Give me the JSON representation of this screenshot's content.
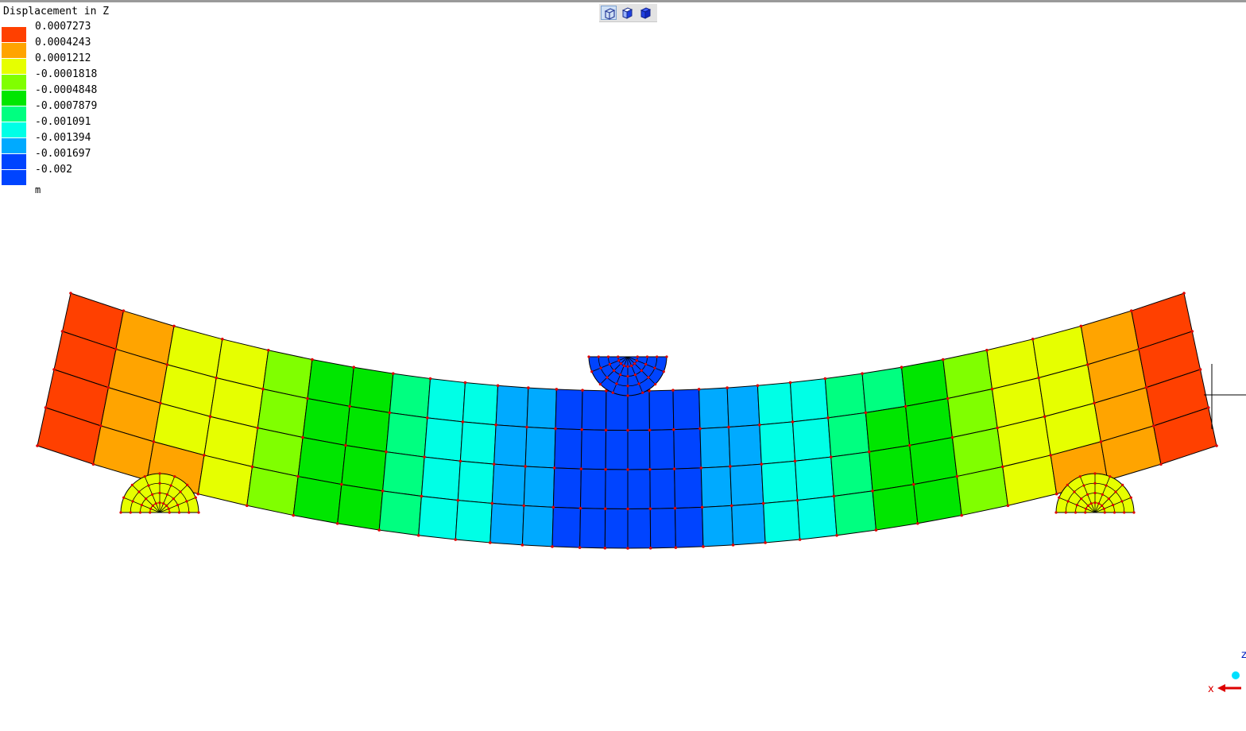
{
  "legend": {
    "title": "Displacement in Z",
    "unit": "m",
    "entries": [
      {
        "label": "0.0007273",
        "color": "#ff4000"
      },
      {
        "label": "0.0004243",
        "color": "#ffa400"
      },
      {
        "label": "0.0001212",
        "color": "#e6ff00"
      },
      {
        "label": "-0.0001818",
        "color": "#80ff00"
      },
      {
        "label": "-0.0004848",
        "color": "#00e600"
      },
      {
        "label": "-0.0007879",
        "color": "#00ff80"
      },
      {
        "label": "-0.001091",
        "color": "#00ffe6"
      },
      {
        "label": "-0.001394",
        "color": "#00aaff"
      },
      {
        "label": "-0.001697",
        "color": "#0044ff"
      },
      {
        "label": "-0.002",
        "color": "#0044ff"
      }
    ]
  },
  "toolbar": {
    "buttons": [
      {
        "icon": "wireframe-cube-icon",
        "active": true
      },
      {
        "icon": "shaded-cube-icon",
        "active": false
      },
      {
        "icon": "solid-cube-icon",
        "active": false
      }
    ]
  },
  "model": {
    "element_count_along_beam": 30,
    "element_count_through_depth": 4,
    "mesh_color": "#000000",
    "node_color": "#dd0000",
    "support_color": "#e6ff00",
    "load_color": "#0044ff"
  },
  "axes": {
    "x_label": "x",
    "z_label": "z"
  }
}
